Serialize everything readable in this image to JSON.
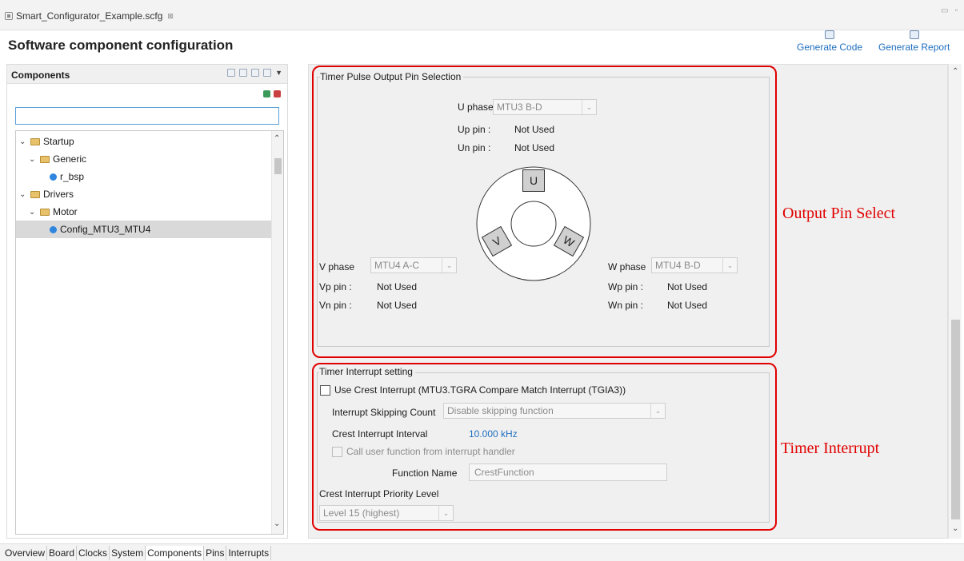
{
  "editor_tab": {
    "filename": "Smart_Configurator_Example.scfg",
    "close_glyph": "⊠"
  },
  "window_controls": {
    "minimize": "▭",
    "restore": "▫"
  },
  "header": {
    "title": "Software component configuration",
    "generate_code": "Generate Code",
    "generate_report": "Generate Report"
  },
  "components": {
    "title": "Components",
    "filter_value": "",
    "tree": [
      {
        "label": "Startup",
        "type": "folder",
        "expanded": true
      },
      {
        "label": "Generic",
        "type": "folder",
        "expanded": true
      },
      {
        "label": "r_bsp",
        "type": "component"
      },
      {
        "label": "Drivers",
        "type": "folder",
        "expanded": true
      },
      {
        "label": "Motor",
        "type": "folder",
        "expanded": true
      },
      {
        "label": "Config_MTU3_MTU4",
        "type": "component",
        "selected": true
      }
    ]
  },
  "pulse_output": {
    "group_title": "Timer Pulse Output Pin Selection",
    "u_phase_label": "U phase",
    "u_phase_value": "MTU3 B-D",
    "up_pin_label": "Up pin :",
    "up_pin_value": "Not Used",
    "un_pin_label": "Un pin :",
    "un_pin_value": "Not Used",
    "v_phase_label": "V phase",
    "v_phase_value": "MTU4 A-C",
    "vp_pin_label": "Vp pin :",
    "vp_pin_value": "Not Used",
    "vn_pin_label": "Vn pin :",
    "vn_pin_value": "Not Used",
    "w_phase_label": "W phase",
    "w_phase_value": "MTU4 B-D",
    "wp_pin_label": "Wp pin :",
    "wp_pin_value": "Not Used",
    "wn_pin_label": "Wn pin :",
    "wn_pin_value": "Not Used",
    "motor_u": "U",
    "motor_v": "V",
    "motor_w": "W"
  },
  "timer_interrupt": {
    "group_title": "Timer Interrupt setting",
    "use_crest": "Use Crest Interrupt (MTU3.TGRA Compare Match Interrupt (TGIA3))",
    "skip_label": "Interrupt Skipping Count",
    "skip_value": "Disable skipping function",
    "interval_label": "Crest Interrupt Interval",
    "interval_value": "10.000 kHz",
    "call_user": "Call user function from interrupt handler",
    "function_name_label": "Function Name",
    "function_name_value": "CrestFunction",
    "priority_label": "Crest Interrupt Priority Level",
    "priority_value": "Level 15 (highest)"
  },
  "annotations": {
    "output_pin_select": "Output Pin Select",
    "timer_interrupt": "Timer Interrupt",
    "color": "#e00000"
  },
  "bottom_tabs": [
    "Overview",
    "Board",
    "Clocks",
    "System",
    "Components",
    "Pins",
    "Interrupts"
  ],
  "active_bottom_tab": "Components"
}
